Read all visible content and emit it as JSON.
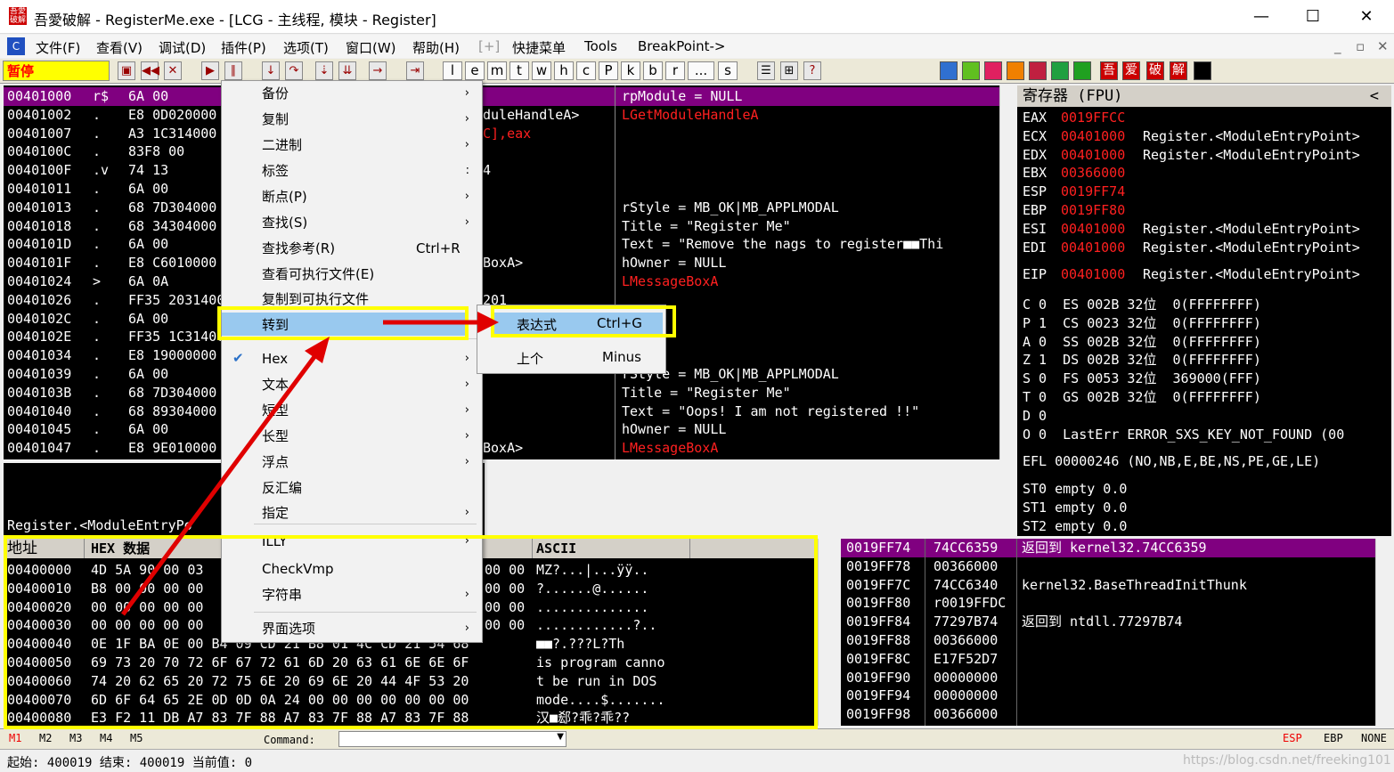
{
  "window": {
    "title": "吾愛破解 - RegisterMe.exe - [LCG - 主线程, 模块 - Register]",
    "icon_text": "吾愛破解",
    "min": "—",
    "max": "☐",
    "close": "✕"
  },
  "menu": [
    "文件(F)",
    "查看(V)",
    "调试(D)",
    "插件(P)",
    "选项(T)",
    "窗口(W)",
    "帮助(H)",
    "[+]",
    "快捷菜单",
    "Tools",
    "BreakPoint->"
  ],
  "menu_right": [
    "_",
    "▫",
    "✕"
  ],
  "toolbar": {
    "status": "暂停",
    "letters": [
      "l",
      "e",
      "m",
      "t",
      "w",
      "h",
      "c",
      "P",
      "k",
      "b",
      "r",
      "...",
      "s"
    ],
    "cn": [
      "吾",
      "爱",
      "破",
      "解"
    ]
  },
  "disasm": {
    "rows": [
      {
        "addr": "00401000",
        "mark": "r$",
        "hex": "6A 00",
        "op": "",
        "cmt": "rpModule = NULL"
      },
      {
        "addr": "00401002",
        "mark": ".",
        "hex": "E8 0D020000",
        "op": "duleHandleA>",
        "cmt": "LGetModuleHandleA"
      },
      {
        "addr": "00401007",
        "mark": ".",
        "hex": "A3 1C314000",
        "op": "C],eax",
        "cmt": ""
      },
      {
        "addr": "0040100C",
        "mark": ".",
        "hex": "83F8 00",
        "op": "",
        "cmt": ""
      },
      {
        "addr": "0040100F",
        "mark": ".v",
        "hex": "74 13",
        "op": "4",
        "cmt": ""
      },
      {
        "addr": "00401011",
        "mark": ".",
        "hex": "6A 00",
        "op": "",
        "cmt": ""
      },
      {
        "addr": "00401013",
        "mark": ".",
        "hex": "68 7D304000",
        "op": "",
        "cmt": "rStyle = MB_OK|MB_APPLMODAL"
      },
      {
        "addr": "00401018",
        "mark": ".",
        "hex": "68 34304000",
        "op": "",
        "cmt": "Title = \"Register Me\""
      },
      {
        "addr": "0040101D",
        "mark": ".",
        "hex": "6A 00",
        "op": "",
        "cmt": "Text = \"Remove the nags to register■■Thi"
      },
      {
        "addr": "0040101F",
        "mark": ".",
        "hex": "E8 C6010000",
        "op": "BoxA>",
        "cmt": "hOwner = NULL"
      },
      {
        "addr": "00401024",
        "mark": ">",
        "hex": "6A 0A",
        "op": "",
        "cmt": "LMessageBoxA"
      },
      {
        "addr": "00401026",
        "mark": ".",
        "hex": "FF35 20314000",
        "op": "201",
        "cmt": ""
      },
      {
        "addr": "0040102C",
        "mark": ".",
        "hex": "6A 00",
        "op": "",
        "cmt": ""
      },
      {
        "addr": "0040102E",
        "mark": ".",
        "hex": "FF35 1C314000",
        "op": "",
        "cmt": ""
      },
      {
        "addr": "00401034",
        "mark": ".",
        "hex": "E8 19000000",
        "op": "",
        "cmt": ""
      },
      {
        "addr": "00401039",
        "mark": ".",
        "hex": "6A 00",
        "op": "",
        "cmt": "rStyle = MB_OK|MB_APPLMODAL"
      },
      {
        "addr": "0040103B",
        "mark": ".",
        "hex": "68 7D304000",
        "op": "",
        "cmt": "Title = \"Register Me\""
      },
      {
        "addr": "00401040",
        "mark": ".",
        "hex": "68 89304000",
        "op": "",
        "cmt": "Text = \"Oops! I am not registered !!\""
      },
      {
        "addr": "00401045",
        "mark": ".",
        "hex": "6A 00",
        "op": "",
        "cmt": "hOwner = NULL"
      },
      {
        "addr": "00401047",
        "mark": ".",
        "hex": "E8 9E010000",
        "op": "BoxA>",
        "cmt": "LMessageBoxA"
      }
    ]
  },
  "info_line": "Register.<ModuleEntryPo",
  "registers": {
    "title": "寄存器 (FPU)",
    "collapse": "<",
    "rows": [
      {
        "n": "EAX",
        "v": "0019FFCC",
        "d": ""
      },
      {
        "n": "ECX",
        "v": "00401000",
        "d": "Register.<ModuleEntryPoint>"
      },
      {
        "n": "EDX",
        "v": "00401000",
        "d": "Register.<ModuleEntryPoint>"
      },
      {
        "n": "EBX",
        "v": "00366000",
        "d": ""
      },
      {
        "n": "ESP",
        "v": "0019FF74",
        "d": ""
      },
      {
        "n": "EBP",
        "v": "0019FF80",
        "d": ""
      },
      {
        "n": "ESI",
        "v": "00401000",
        "d": "Register.<ModuleEntryPoint>"
      },
      {
        "n": "EDI",
        "v": "00401000",
        "d": "Register.<ModuleEntryPoint>"
      },
      {
        "n": "EIP",
        "v": "00401000",
        "d": "Register.<ModuleEntryPoint>"
      }
    ],
    "flags": [
      "C 0  ES 002B 32位  0(FFFFFFFF)",
      "P 1  CS 0023 32位  0(FFFFFFFF)",
      "A 0  SS 002B 32位  0(FFFFFFFF)",
      "Z 1  DS 002B 32位  0(FFFFFFFF)",
      "S 0  FS 0053 32位  369000(FFF)",
      "T 0  GS 002B 32位  0(FFFFFFFF)",
      "D 0",
      "O 0  LastErr ERROR_SXS_KEY_NOT_FOUND (00"
    ],
    "efl": "EFL 00000246 (NO,NB,E,BE,NS,PE,GE,LE)",
    "st": [
      "ST0 empty 0.0",
      "ST1 empty 0.0",
      "ST2 empty 0.0"
    ]
  },
  "dump": {
    "h_addr": "地址",
    "h_hex": "HEX 数据",
    "h_ascii": "ASCII",
    "rows": [
      {
        "a": "00400000",
        "h": "4D 5A 90 00 03",
        "h2": "00 00",
        "s": "MZ?...|...ÿÿ.."
      },
      {
        "a": "00400010",
        "h": "B8 00 00 00 00",
        "h2": "00 00",
        "s": "?......@......"
      },
      {
        "a": "00400020",
        "h": "00 00 00 00 00",
        "h2": "00 00",
        "s": ".............."
      },
      {
        "a": "00400030",
        "h": "00 00 00 00 00",
        "h2": "00 00",
        "s": "............?.."
      },
      {
        "a": "00400040",
        "h": "0E 1F BA 0E 00 B4 09 CD 21 B8 01 4C CD 21 54 68",
        "h2": "",
        "s": "■■?.???L?Th"
      },
      {
        "a": "00400050",
        "h": "69 73 20 70 72 6F 67 72 61 6D 20 63 61 6E 6E 6F",
        "h2": "",
        "s": "is program canno"
      },
      {
        "a": "00400060",
        "h": "74 20 62 65 20 72 75 6E 20 69 6E 20 44 4F 53 20",
        "h2": "",
        "s": "t be run in DOS "
      },
      {
        "a": "00400070",
        "h": "6D 6F 64 65 2E 0D 0D 0A 24 00 00 00 00 00 00 00",
        "h2": "",
        "s": "mode....$......."
      },
      {
        "a": "00400080",
        "h": "E3 F2 11 DB A7 83 7F 88 A7 83 7F 88 A7 83 7F 88",
        "h2": "",
        "s": "汉■郄?乖?乖??"
      }
    ]
  },
  "stack": {
    "rows": [
      {
        "a": "0019FF74",
        "v": "74CC6359",
        "d": "返回到 kernel32.74CC6359"
      },
      {
        "a": "0019FF78",
        "v": "00366000",
        "d": ""
      },
      {
        "a": "0019FF7C",
        "v": "74CC6340",
        "d": "kernel32.BaseThreadInitThunk"
      },
      {
        "a": "0019FF80",
        "v": "r0019FFDC",
        "d": ""
      },
      {
        "a": "0019FF84",
        "v": "77297B74",
        "d": "返回到 ntdll.77297B74"
      },
      {
        "a": "0019FF88",
        "v": "00366000",
        "d": ""
      },
      {
        "a": "0019FF8C",
        "v": "E17F52D7",
        "d": ""
      },
      {
        "a": "0019FF90",
        "v": "00000000",
        "d": ""
      },
      {
        "a": "0019FF94",
        "v": "00000000",
        "d": ""
      },
      {
        "a": "0019FF98",
        "v": "00366000",
        "d": ""
      }
    ]
  },
  "context_menu": {
    "items": [
      {
        "t": "备份",
        "a": "›",
        "s": ""
      },
      {
        "t": "复制",
        "a": "›",
        "s": ""
      },
      {
        "t": "二进制",
        "a": "›",
        "s": ""
      },
      {
        "t": "标签",
        "a": ":",
        "s": ""
      },
      {
        "t": "断点(P)",
        "a": "›",
        "s": ""
      },
      {
        "t": "查找(S)",
        "a": "›",
        "s": ""
      },
      {
        "t": "查找参考(R)",
        "a": "",
        "s": "Ctrl+R"
      },
      {
        "t": "查看可执行文件(E)",
        "a": "",
        "s": ""
      },
      {
        "t": "复制到可执行文件",
        "a": "",
        "s": ""
      },
      {
        "t": "转到",
        "a": "›",
        "s": ""
      },
      {
        "t": "Hex",
        "a": "›",
        "s": ""
      },
      {
        "t": "文本",
        "a": "›",
        "s": ""
      },
      {
        "t": "短型",
        "a": "›",
        "s": ""
      },
      {
        "t": "长型",
        "a": "›",
        "s": ""
      },
      {
        "t": "浮点",
        "a": "›",
        "s": ""
      },
      {
        "t": "反汇编",
        "a": "",
        "s": ""
      },
      {
        "t": "指定",
        "a": "›",
        "s": ""
      },
      {
        "t": "ILLY",
        "a": "›",
        "s": ""
      },
      {
        "t": "CheckVmp",
        "a": "",
        "s": ""
      },
      {
        "t": "字符串",
        "a": "›",
        "s": ""
      },
      {
        "t": "界面选项",
        "a": "›",
        "s": ""
      }
    ],
    "check": "✔"
  },
  "submenu": [
    {
      "t": "表达式",
      "s": "Ctrl+G"
    },
    {
      "t": "上个",
      "s": "Minus"
    }
  ],
  "cmdbar": {
    "marks": [
      "M1",
      "M2",
      "M3",
      "M4",
      "M5"
    ],
    "label": "Command:",
    "right": [
      "ESP",
      "EBP",
      "NONE"
    ]
  },
  "status": "起始: 400019 结束: 400019 当前值: 0",
  "watermark": "https://blog.csdn.net/freeking101",
  "colors": {
    "accent_red": "#ff2020",
    "highlight": "#800080",
    "annotation": "#ffff00",
    "arrow": "#e00000"
  }
}
